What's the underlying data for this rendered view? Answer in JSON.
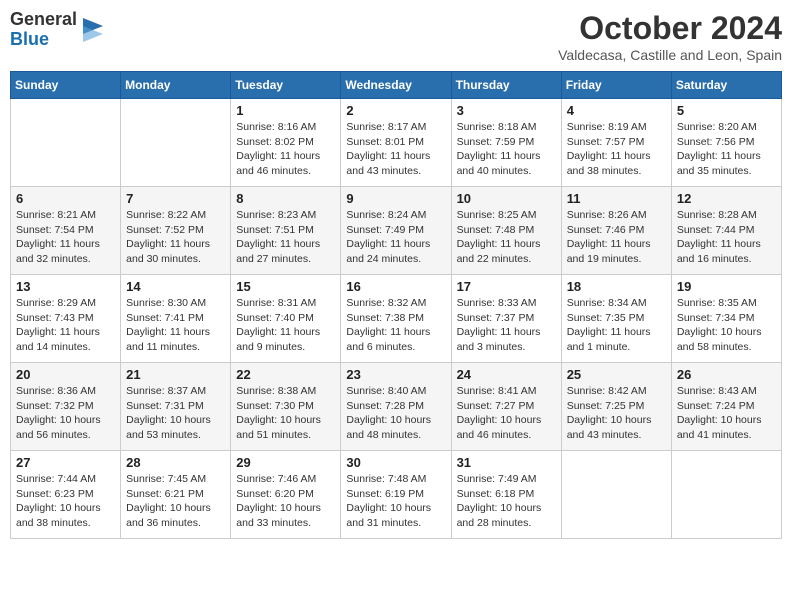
{
  "header": {
    "logo_general": "General",
    "logo_blue": "Blue",
    "month_title": "October 2024",
    "location": "Valdecasa, Castille and Leon, Spain"
  },
  "weekdays": [
    "Sunday",
    "Monday",
    "Tuesday",
    "Wednesday",
    "Thursday",
    "Friday",
    "Saturday"
  ],
  "weeks": [
    [
      {
        "day": "",
        "sunrise": "",
        "sunset": "",
        "daylight": ""
      },
      {
        "day": "",
        "sunrise": "",
        "sunset": "",
        "daylight": ""
      },
      {
        "day": "1",
        "sunrise": "Sunrise: 8:16 AM",
        "sunset": "Sunset: 8:02 PM",
        "daylight": "Daylight: 11 hours and 46 minutes."
      },
      {
        "day": "2",
        "sunrise": "Sunrise: 8:17 AM",
        "sunset": "Sunset: 8:01 PM",
        "daylight": "Daylight: 11 hours and 43 minutes."
      },
      {
        "day": "3",
        "sunrise": "Sunrise: 8:18 AM",
        "sunset": "Sunset: 7:59 PM",
        "daylight": "Daylight: 11 hours and 40 minutes."
      },
      {
        "day": "4",
        "sunrise": "Sunrise: 8:19 AM",
        "sunset": "Sunset: 7:57 PM",
        "daylight": "Daylight: 11 hours and 38 minutes."
      },
      {
        "day": "5",
        "sunrise": "Sunrise: 8:20 AM",
        "sunset": "Sunset: 7:56 PM",
        "daylight": "Daylight: 11 hours and 35 minutes."
      }
    ],
    [
      {
        "day": "6",
        "sunrise": "Sunrise: 8:21 AM",
        "sunset": "Sunset: 7:54 PM",
        "daylight": "Daylight: 11 hours and 32 minutes."
      },
      {
        "day": "7",
        "sunrise": "Sunrise: 8:22 AM",
        "sunset": "Sunset: 7:52 PM",
        "daylight": "Daylight: 11 hours and 30 minutes."
      },
      {
        "day": "8",
        "sunrise": "Sunrise: 8:23 AM",
        "sunset": "Sunset: 7:51 PM",
        "daylight": "Daylight: 11 hours and 27 minutes."
      },
      {
        "day": "9",
        "sunrise": "Sunrise: 8:24 AM",
        "sunset": "Sunset: 7:49 PM",
        "daylight": "Daylight: 11 hours and 24 minutes."
      },
      {
        "day": "10",
        "sunrise": "Sunrise: 8:25 AM",
        "sunset": "Sunset: 7:48 PM",
        "daylight": "Daylight: 11 hours and 22 minutes."
      },
      {
        "day": "11",
        "sunrise": "Sunrise: 8:26 AM",
        "sunset": "Sunset: 7:46 PM",
        "daylight": "Daylight: 11 hours and 19 minutes."
      },
      {
        "day": "12",
        "sunrise": "Sunrise: 8:28 AM",
        "sunset": "Sunset: 7:44 PM",
        "daylight": "Daylight: 11 hours and 16 minutes."
      }
    ],
    [
      {
        "day": "13",
        "sunrise": "Sunrise: 8:29 AM",
        "sunset": "Sunset: 7:43 PM",
        "daylight": "Daylight: 11 hours and 14 minutes."
      },
      {
        "day": "14",
        "sunrise": "Sunrise: 8:30 AM",
        "sunset": "Sunset: 7:41 PM",
        "daylight": "Daylight: 11 hours and 11 minutes."
      },
      {
        "day": "15",
        "sunrise": "Sunrise: 8:31 AM",
        "sunset": "Sunset: 7:40 PM",
        "daylight": "Daylight: 11 hours and 9 minutes."
      },
      {
        "day": "16",
        "sunrise": "Sunrise: 8:32 AM",
        "sunset": "Sunset: 7:38 PM",
        "daylight": "Daylight: 11 hours and 6 minutes."
      },
      {
        "day": "17",
        "sunrise": "Sunrise: 8:33 AM",
        "sunset": "Sunset: 7:37 PM",
        "daylight": "Daylight: 11 hours and 3 minutes."
      },
      {
        "day": "18",
        "sunrise": "Sunrise: 8:34 AM",
        "sunset": "Sunset: 7:35 PM",
        "daylight": "Daylight: 11 hours and 1 minute."
      },
      {
        "day": "19",
        "sunrise": "Sunrise: 8:35 AM",
        "sunset": "Sunset: 7:34 PM",
        "daylight": "Daylight: 10 hours and 58 minutes."
      }
    ],
    [
      {
        "day": "20",
        "sunrise": "Sunrise: 8:36 AM",
        "sunset": "Sunset: 7:32 PM",
        "daylight": "Daylight: 10 hours and 56 minutes."
      },
      {
        "day": "21",
        "sunrise": "Sunrise: 8:37 AM",
        "sunset": "Sunset: 7:31 PM",
        "daylight": "Daylight: 10 hours and 53 minutes."
      },
      {
        "day": "22",
        "sunrise": "Sunrise: 8:38 AM",
        "sunset": "Sunset: 7:30 PM",
        "daylight": "Daylight: 10 hours and 51 minutes."
      },
      {
        "day": "23",
        "sunrise": "Sunrise: 8:40 AM",
        "sunset": "Sunset: 7:28 PM",
        "daylight": "Daylight: 10 hours and 48 minutes."
      },
      {
        "day": "24",
        "sunrise": "Sunrise: 8:41 AM",
        "sunset": "Sunset: 7:27 PM",
        "daylight": "Daylight: 10 hours and 46 minutes."
      },
      {
        "day": "25",
        "sunrise": "Sunrise: 8:42 AM",
        "sunset": "Sunset: 7:25 PM",
        "daylight": "Daylight: 10 hours and 43 minutes."
      },
      {
        "day": "26",
        "sunrise": "Sunrise: 8:43 AM",
        "sunset": "Sunset: 7:24 PM",
        "daylight": "Daylight: 10 hours and 41 minutes."
      }
    ],
    [
      {
        "day": "27",
        "sunrise": "Sunrise: 7:44 AM",
        "sunset": "Sunset: 6:23 PM",
        "daylight": "Daylight: 10 hours and 38 minutes."
      },
      {
        "day": "28",
        "sunrise": "Sunrise: 7:45 AM",
        "sunset": "Sunset: 6:21 PM",
        "daylight": "Daylight: 10 hours and 36 minutes."
      },
      {
        "day": "29",
        "sunrise": "Sunrise: 7:46 AM",
        "sunset": "Sunset: 6:20 PM",
        "daylight": "Daylight: 10 hours and 33 minutes."
      },
      {
        "day": "30",
        "sunrise": "Sunrise: 7:48 AM",
        "sunset": "Sunset: 6:19 PM",
        "daylight": "Daylight: 10 hours and 31 minutes."
      },
      {
        "day": "31",
        "sunrise": "Sunrise: 7:49 AM",
        "sunset": "Sunset: 6:18 PM",
        "daylight": "Daylight: 10 hours and 28 minutes."
      },
      {
        "day": "",
        "sunrise": "",
        "sunset": "",
        "daylight": ""
      },
      {
        "day": "",
        "sunrise": "",
        "sunset": "",
        "daylight": ""
      }
    ]
  ]
}
